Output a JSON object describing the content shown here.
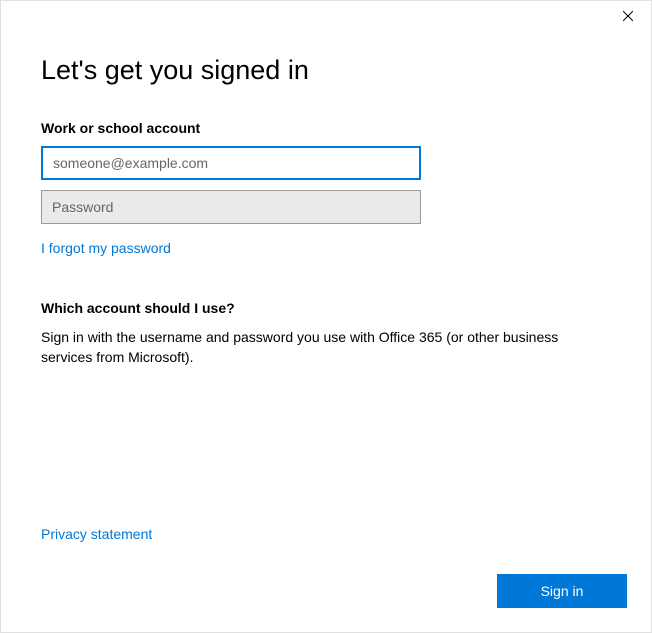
{
  "header": {
    "title": "Let's get you signed in"
  },
  "form": {
    "account_label": "Work or school account",
    "email_placeholder": "someone@example.com",
    "password_placeholder": "Password",
    "forgot_link": "I forgot my password"
  },
  "help": {
    "heading": "Which account should I use?",
    "body": "Sign in with the username and password you use with Office 365 (or other business services from Microsoft)."
  },
  "footer": {
    "privacy_link": "Privacy statement",
    "signin_button": "Sign in"
  },
  "colors": {
    "accent": "#0078d7"
  }
}
